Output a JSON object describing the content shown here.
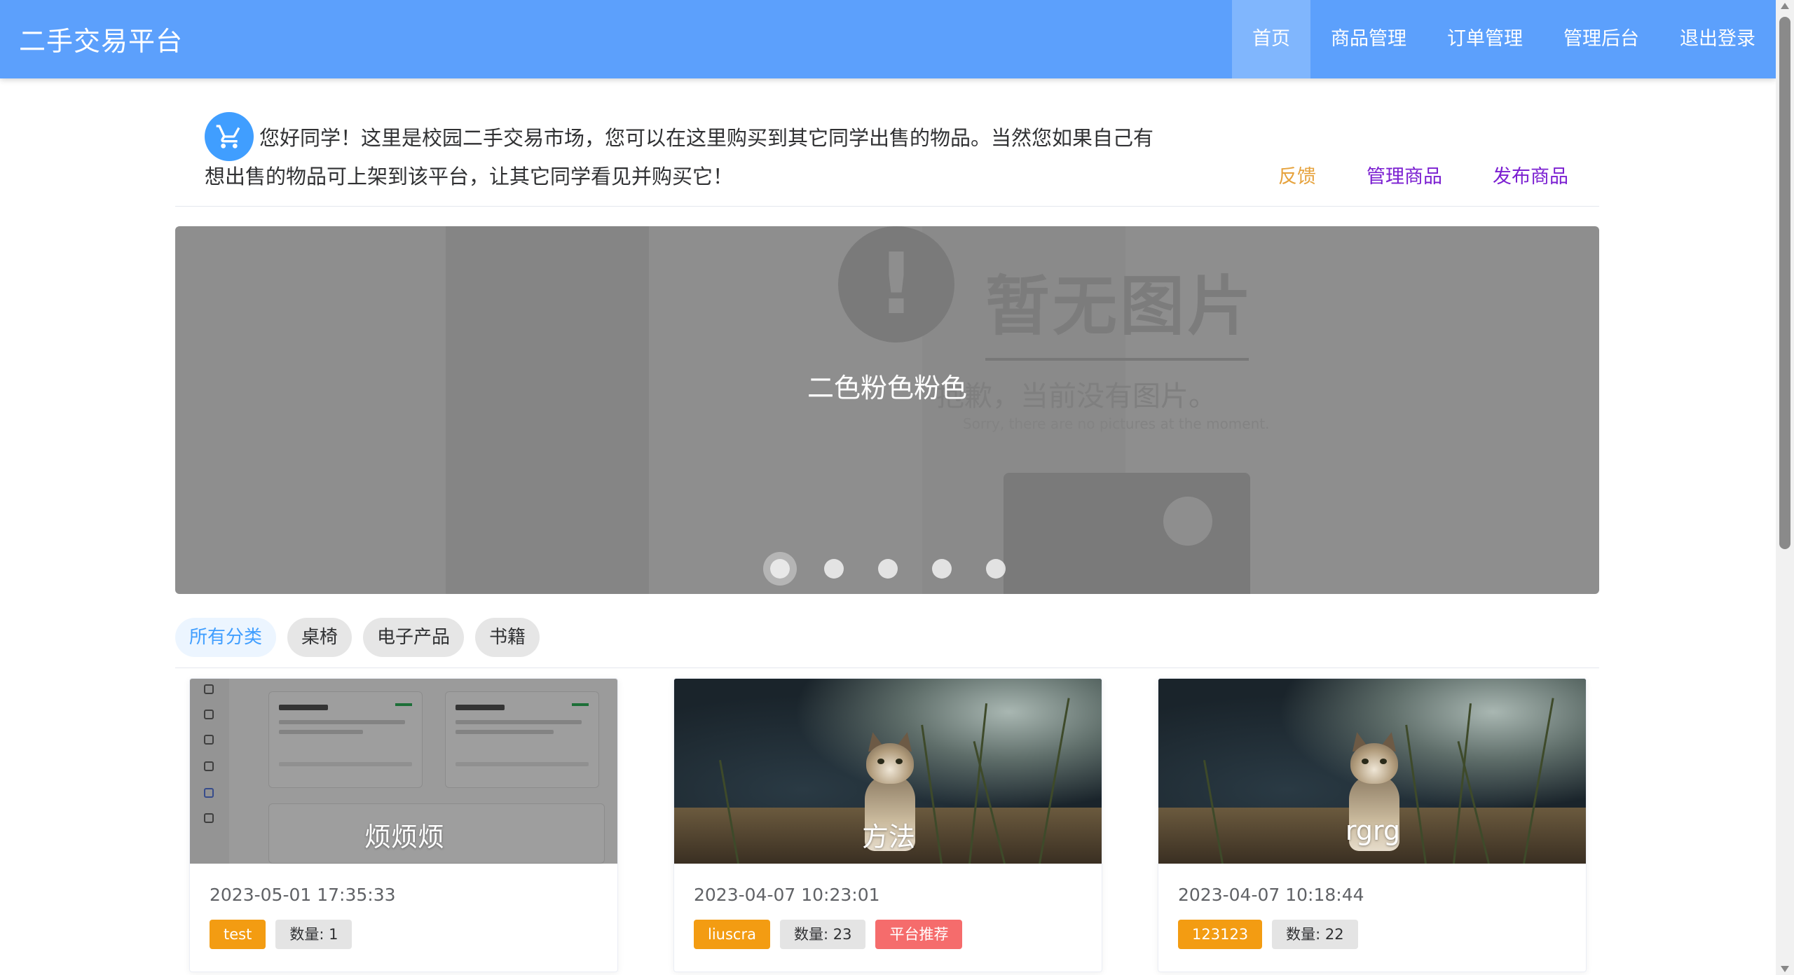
{
  "header": {
    "brand": "二手交易平台",
    "nav": [
      {
        "label": "首页",
        "active": true
      },
      {
        "label": "商品管理",
        "active": false
      },
      {
        "label": "订单管理",
        "active": false
      },
      {
        "label": "管理后台",
        "active": false
      },
      {
        "label": "退出登录",
        "active": false
      }
    ]
  },
  "welcome": {
    "icon": "cart-icon",
    "text": "您好同学！这里是校园二手交易市场，您可以在这里购买到其它同学出售的物品。当然您如果自己有想出售的物品可上架到该平台，让其它同学看见并购买它！",
    "actions": {
      "feedback": "反馈",
      "manage": "管理商品",
      "publish": "发布商品"
    }
  },
  "carousel": {
    "caption": "二色粉色粉色",
    "placeholder": {
      "title": "暂无图片",
      "subtitle": "抱歉，当前没有图片。",
      "english": "Sorry, there are no pictures at the moment."
    },
    "slide_count": 5,
    "active_index": 0
  },
  "categories": [
    {
      "label": "所有分类",
      "active": true
    },
    {
      "label": "桌椅",
      "active": false
    },
    {
      "label": "电子产品",
      "active": false
    },
    {
      "label": "书籍",
      "active": false
    }
  ],
  "products": [
    {
      "title": "烦烦烦",
      "time": "2023-05-01 17:35:33",
      "seller": "test",
      "quantity": "数量: 1",
      "recommended": null,
      "image": "screenshot"
    },
    {
      "title": "方法",
      "time": "2023-04-07 10:23:01",
      "seller": "liuscra",
      "quantity": "数量: 23",
      "recommended": "平台推荐",
      "image": "cat-photo"
    },
    {
      "title": "rgrg",
      "time": "2023-04-07 10:18:44",
      "seller": "123123",
      "quantity": "数量: 22",
      "recommended": null,
      "image": "cat-photo"
    }
  ],
  "colors": {
    "header_bg": "#5ca0fc",
    "nav_active_bg": "#80b6fd",
    "feedback": "#e6a23c",
    "link_purple": "#7b1fd1",
    "tag_seller": "#f39c12",
    "tag_recommend": "#f56c6c"
  }
}
